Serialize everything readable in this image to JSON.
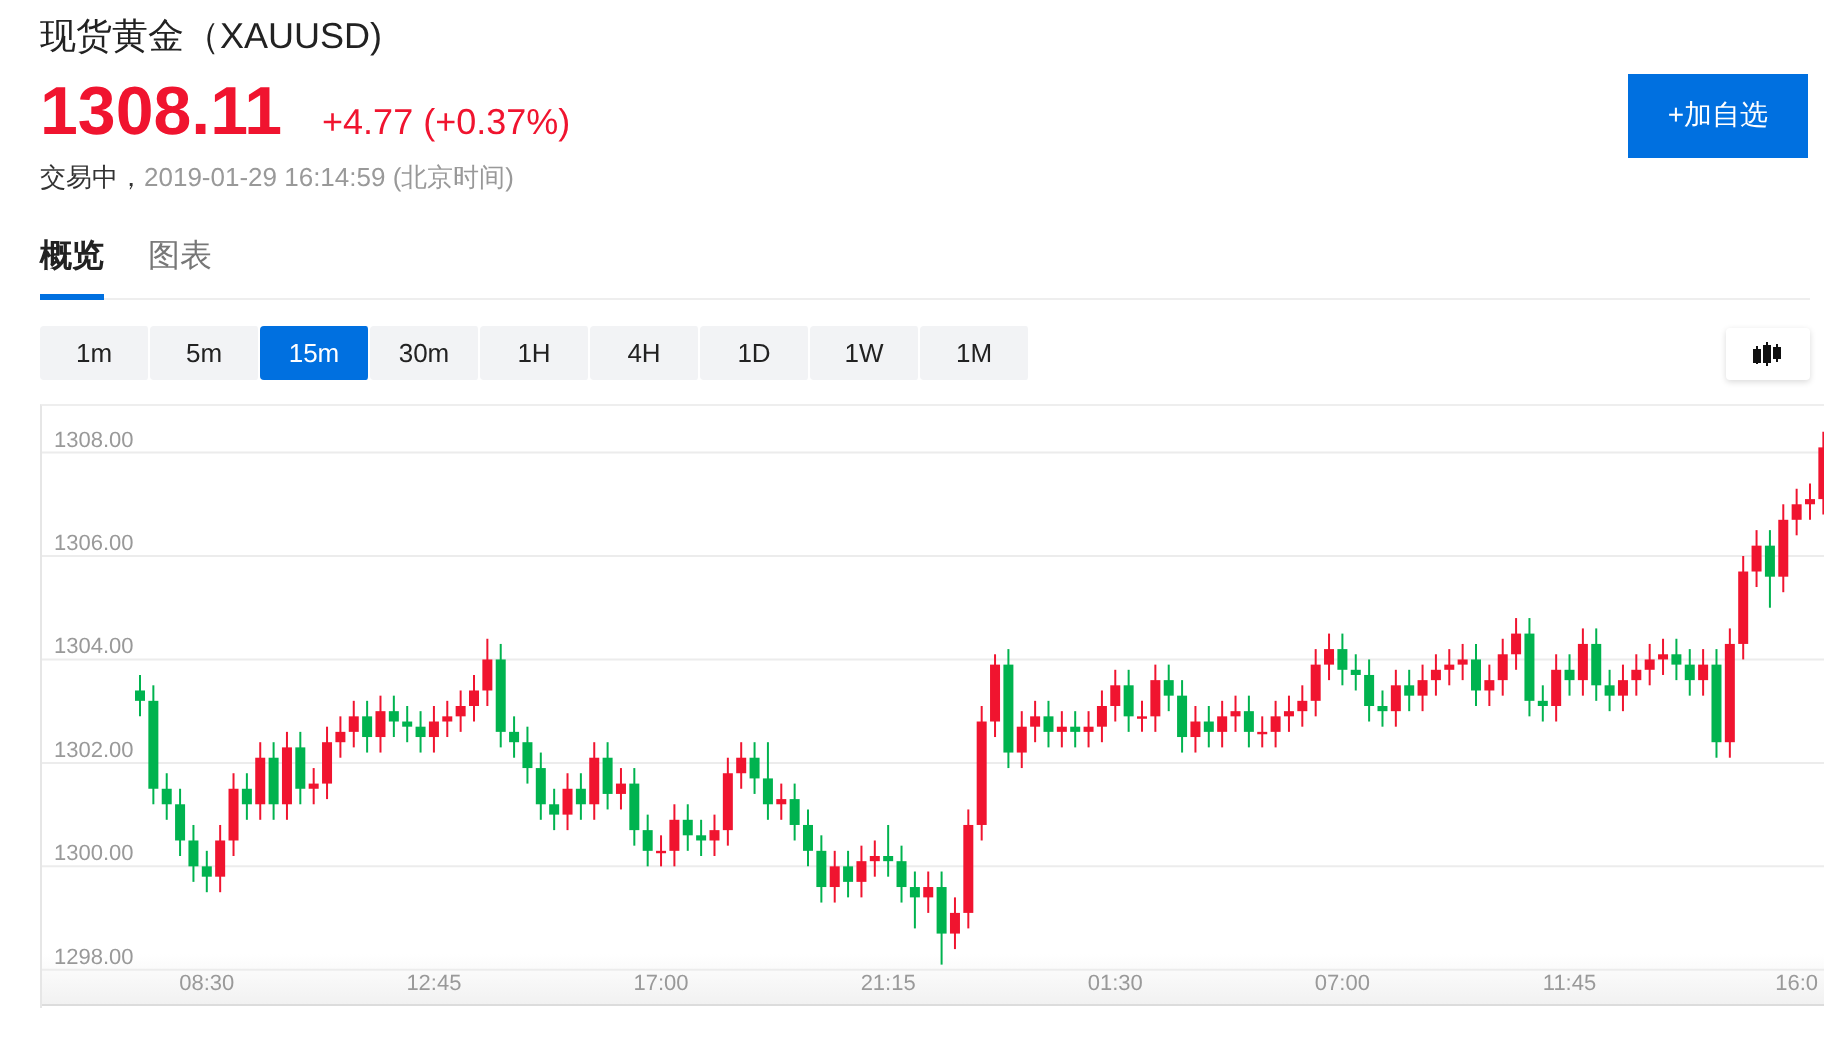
{
  "header": {
    "title": "现货黄金（XAUUSD)",
    "price": "1308.11",
    "change": "+4.77 (+0.37%)",
    "state": "交易中，",
    "timestamp": "2019-01-29 16:14:59 (北京时间)",
    "watch_button": "+加自选"
  },
  "tabs": [
    {
      "label": "概览",
      "selected": true
    },
    {
      "label": "图表",
      "selected": false
    }
  ],
  "intervals": [
    {
      "label": "1m",
      "selected": false
    },
    {
      "label": "5m",
      "selected": false
    },
    {
      "label": "15m",
      "selected": true
    },
    {
      "label": "30m",
      "selected": false
    },
    {
      "label": "1H",
      "selected": false
    },
    {
      "label": "4H",
      "selected": false
    },
    {
      "label": "1D",
      "selected": false
    },
    {
      "label": "1W",
      "selected": false
    },
    {
      "label": "1M",
      "selected": false
    }
  ],
  "chart": {
    "chart_data": {
      "type": "candlestick",
      "yticks": [
        {
          "value": 1308,
          "label": "1308.00"
        },
        {
          "value": 1306,
          "label": "1306.00"
        },
        {
          "value": 1304,
          "label": "1304.00"
        },
        {
          "value": 1302,
          "label": "1302.00"
        },
        {
          "value": 1300,
          "label": "1300.00"
        },
        {
          "value": 1298,
          "label": "1298.00"
        }
      ],
      "ylim": [
        1297.3,
        1308.9
      ],
      "grid": true,
      "categories": [
        null,
        null,
        null,
        null,
        null,
        "08:30",
        null,
        null,
        null,
        null,
        null,
        null,
        null,
        null,
        null,
        null,
        null,
        null,
        null,
        null,
        null,
        null,
        "12:45",
        null,
        null,
        null,
        null,
        null,
        null,
        null,
        null,
        null,
        null,
        null,
        null,
        null,
        null,
        null,
        null,
        "17:00",
        null,
        null,
        null,
        null,
        null,
        null,
        null,
        null,
        null,
        null,
        null,
        null,
        null,
        null,
        null,
        null,
        "21:15",
        null,
        null,
        null,
        null,
        null,
        null,
        null,
        null,
        null,
        null,
        null,
        null,
        null,
        null,
        null,
        null,
        "01:30",
        null,
        null,
        null,
        null,
        null,
        null,
        null,
        null,
        null,
        null,
        null,
        null,
        null,
        null,
        null,
        null,
        "07:00",
        null,
        null,
        null,
        null,
        null,
        null,
        null,
        null,
        null,
        null,
        null,
        null,
        null,
        null,
        null,
        null,
        "11:45",
        null,
        null,
        null,
        null,
        null,
        null,
        null,
        null,
        null,
        null,
        null,
        null,
        null,
        null,
        null,
        null,
        "16:0",
        null,
        null
      ],
      "ohlc": [
        [
          1303.4,
          1303.7,
          1302.9,
          1303.2
        ],
        [
          1303.2,
          1303.5,
          1301.2,
          1301.5
        ],
        [
          1301.5,
          1301.8,
          1300.9,
          1301.2
        ],
        [
          1301.2,
          1301.5,
          1300.2,
          1300.5
        ],
        [
          1300.5,
          1300.8,
          1299.7,
          1300.0
        ],
        [
          1300.0,
          1300.3,
          1299.5,
          1299.8
        ],
        [
          1299.8,
          1300.8,
          1299.5,
          1300.5
        ],
        [
          1300.5,
          1301.8,
          1300.2,
          1301.5
        ],
        [
          1301.5,
          1301.8,
          1300.9,
          1301.2
        ],
        [
          1301.2,
          1302.4,
          1300.9,
          1302.1
        ],
        [
          1302.1,
          1302.4,
          1300.9,
          1301.2
        ],
        [
          1301.2,
          1302.6,
          1300.9,
          1302.3
        ],
        [
          1302.3,
          1302.6,
          1301.2,
          1301.5
        ],
        [
          1301.5,
          1301.9,
          1301.2,
          1301.6
        ],
        [
          1301.6,
          1302.7,
          1301.3,
          1302.4
        ],
        [
          1302.4,
          1302.9,
          1302.1,
          1302.6
        ],
        [
          1302.6,
          1303.2,
          1302.3,
          1302.9
        ],
        [
          1302.9,
          1303.2,
          1302.2,
          1302.5
        ],
        [
          1302.5,
          1303.3,
          1302.2,
          1303.0
        ],
        [
          1303.0,
          1303.3,
          1302.5,
          1302.8
        ],
        [
          1302.8,
          1303.1,
          1302.4,
          1302.7
        ],
        [
          1302.7,
          1303.0,
          1302.2,
          1302.5
        ],
        [
          1302.5,
          1303.1,
          1302.2,
          1302.8
        ],
        [
          1302.8,
          1303.2,
          1302.5,
          1302.9
        ],
        [
          1302.9,
          1303.4,
          1302.6,
          1303.1
        ],
        [
          1303.1,
          1303.7,
          1302.8,
          1303.4
        ],
        [
          1303.4,
          1304.4,
          1303.1,
          1304.0
        ],
        [
          1304.0,
          1304.3,
          1302.3,
          1302.6
        ],
        [
          1302.6,
          1302.9,
          1302.1,
          1302.4
        ],
        [
          1302.4,
          1302.7,
          1301.6,
          1301.9
        ],
        [
          1301.9,
          1302.2,
          1300.9,
          1301.2
        ],
        [
          1301.2,
          1301.5,
          1300.7,
          1301.0
        ],
        [
          1301.0,
          1301.8,
          1300.7,
          1301.5
        ],
        [
          1301.5,
          1301.8,
          1300.9,
          1301.2
        ],
        [
          1301.2,
          1302.4,
          1300.9,
          1302.1
        ],
        [
          1302.1,
          1302.4,
          1301.1,
          1301.4
        ],
        [
          1301.4,
          1301.9,
          1301.1,
          1301.6
        ],
        [
          1301.6,
          1301.9,
          1300.4,
          1300.7
        ],
        [
          1300.7,
          1301.0,
          1300.0,
          1300.3
        ],
        [
          1300.3,
          1300.6,
          1300.0,
          1300.3
        ],
        [
          1300.3,
          1301.2,
          1300.0,
          1300.9
        ],
        [
          1300.9,
          1301.2,
          1300.3,
          1300.6
        ],
        [
          1300.6,
          1300.9,
          1300.2,
          1300.5
        ],
        [
          1300.5,
          1301.0,
          1300.2,
          1300.7
        ],
        [
          1300.7,
          1302.1,
          1300.4,
          1301.8
        ],
        [
          1301.8,
          1302.4,
          1301.5,
          1302.1
        ],
        [
          1302.1,
          1302.4,
          1301.4,
          1301.7
        ],
        [
          1301.7,
          1302.4,
          1300.9,
          1301.2
        ],
        [
          1301.2,
          1301.6,
          1300.9,
          1301.3
        ],
        [
          1301.3,
          1301.6,
          1300.5,
          1300.8
        ],
        [
          1300.8,
          1301.1,
          1300.0,
          1300.3
        ],
        [
          1300.3,
          1300.6,
          1299.3,
          1299.6
        ],
        [
          1299.6,
          1300.3,
          1299.3,
          1300.0
        ],
        [
          1300.0,
          1300.3,
          1299.4,
          1299.7
        ],
        [
          1299.7,
          1300.4,
          1299.4,
          1300.1
        ],
        [
          1300.1,
          1300.5,
          1299.8,
          1300.2
        ],
        [
          1300.2,
          1300.8,
          1299.8,
          1300.1
        ],
        [
          1300.1,
          1300.4,
          1299.3,
          1299.6
        ],
        [
          1299.6,
          1299.9,
          1298.8,
          1299.4
        ],
        [
          1299.4,
          1299.9,
          1299.1,
          1299.6
        ],
        [
          1299.6,
          1299.9,
          1298.1,
          1298.7
        ],
        [
          1298.7,
          1299.4,
          1298.4,
          1299.1
        ],
        [
          1299.1,
          1301.1,
          1298.8,
          1300.8
        ],
        [
          1300.8,
          1303.1,
          1300.5,
          1302.8
        ],
        [
          1302.8,
          1304.1,
          1302.5,
          1303.9
        ],
        [
          1303.9,
          1304.2,
          1301.9,
          1302.2
        ],
        [
          1302.2,
          1303.0,
          1301.9,
          1302.7
        ],
        [
          1302.7,
          1303.2,
          1302.4,
          1302.9
        ],
        [
          1302.9,
          1303.2,
          1302.3,
          1302.6
        ],
        [
          1302.6,
          1303.0,
          1302.3,
          1302.7
        ],
        [
          1302.7,
          1303.0,
          1302.3,
          1302.6
        ],
        [
          1302.6,
          1303.0,
          1302.3,
          1302.7
        ],
        [
          1302.7,
          1303.4,
          1302.4,
          1303.1
        ],
        [
          1303.1,
          1303.8,
          1302.8,
          1303.5
        ],
        [
          1303.5,
          1303.8,
          1302.6,
          1302.9
        ],
        [
          1302.9,
          1303.2,
          1302.6,
          1302.9
        ],
        [
          1302.9,
          1303.9,
          1302.6,
          1303.6
        ],
        [
          1303.6,
          1303.9,
          1303.0,
          1303.3
        ],
        [
          1303.3,
          1303.6,
          1302.2,
          1302.5
        ],
        [
          1302.5,
          1303.1,
          1302.2,
          1302.8
        ],
        [
          1302.8,
          1303.1,
          1302.3,
          1302.6
        ],
        [
          1302.6,
          1303.2,
          1302.3,
          1302.9
        ],
        [
          1302.9,
          1303.3,
          1302.6,
          1303.0
        ],
        [
          1303.0,
          1303.3,
          1302.3,
          1302.6
        ],
        [
          1302.6,
          1302.9,
          1302.3,
          1302.6
        ],
        [
          1302.6,
          1303.2,
          1302.3,
          1302.9
        ],
        [
          1302.9,
          1303.3,
          1302.6,
          1303.0
        ],
        [
          1303.0,
          1303.5,
          1302.7,
          1303.2
        ],
        [
          1303.2,
          1304.2,
          1302.9,
          1303.9
        ],
        [
          1303.9,
          1304.5,
          1303.6,
          1304.2
        ],
        [
          1304.2,
          1304.5,
          1303.5,
          1303.8
        ],
        [
          1303.8,
          1304.1,
          1303.4,
          1303.7
        ],
        [
          1303.7,
          1304.0,
          1302.8,
          1303.1
        ],
        [
          1303.1,
          1303.4,
          1302.7,
          1303.0
        ],
        [
          1303.0,
          1303.8,
          1302.7,
          1303.5
        ],
        [
          1303.5,
          1303.8,
          1303.0,
          1303.3
        ],
        [
          1303.3,
          1303.9,
          1303.0,
          1303.6
        ],
        [
          1303.6,
          1304.1,
          1303.3,
          1303.8
        ],
        [
          1303.8,
          1304.2,
          1303.5,
          1303.9
        ],
        [
          1303.9,
          1304.3,
          1303.6,
          1304.0
        ],
        [
          1304.0,
          1304.3,
          1303.1,
          1303.4
        ],
        [
          1303.4,
          1303.9,
          1303.1,
          1303.6
        ],
        [
          1303.6,
          1304.4,
          1303.3,
          1304.1
        ],
        [
          1304.1,
          1304.8,
          1303.8,
          1304.5
        ],
        [
          1304.5,
          1304.8,
          1302.9,
          1303.2
        ],
        [
          1303.2,
          1303.5,
          1302.8,
          1303.1
        ],
        [
          1303.1,
          1304.1,
          1302.8,
          1303.8
        ],
        [
          1303.8,
          1304.1,
          1303.3,
          1303.6
        ],
        [
          1303.6,
          1304.6,
          1303.3,
          1304.3
        ],
        [
          1304.3,
          1304.6,
          1303.2,
          1303.5
        ],
        [
          1303.5,
          1303.8,
          1303.0,
          1303.3
        ],
        [
          1303.3,
          1303.9,
          1303.0,
          1303.6
        ],
        [
          1303.6,
          1304.1,
          1303.3,
          1303.8
        ],
        [
          1303.8,
          1304.3,
          1303.5,
          1304.0
        ],
        [
          1304.0,
          1304.4,
          1303.7,
          1304.1
        ],
        [
          1304.1,
          1304.4,
          1303.6,
          1303.9
        ],
        [
          1303.9,
          1304.2,
          1303.3,
          1303.6
        ],
        [
          1303.6,
          1304.2,
          1303.3,
          1303.9
        ],
        [
          1303.9,
          1304.2,
          1302.1,
          1302.4
        ],
        [
          1302.4,
          1304.6,
          1302.1,
          1304.3
        ],
        [
          1304.3,
          1306.0,
          1304.0,
          1305.7
        ],
        [
          1305.7,
          1306.5,
          1305.4,
          1306.2
        ],
        [
          1306.2,
          1306.5,
          1305.0,
          1305.6
        ],
        [
          1305.6,
          1307.0,
          1305.3,
          1306.7
        ],
        [
          1306.7,
          1307.3,
          1306.4,
          1307.0
        ],
        [
          1307.0,
          1307.4,
          1306.7,
          1307.1
        ],
        [
          1307.1,
          1308.4,
          1306.8,
          1308.1
        ]
      ]
    }
  }
}
